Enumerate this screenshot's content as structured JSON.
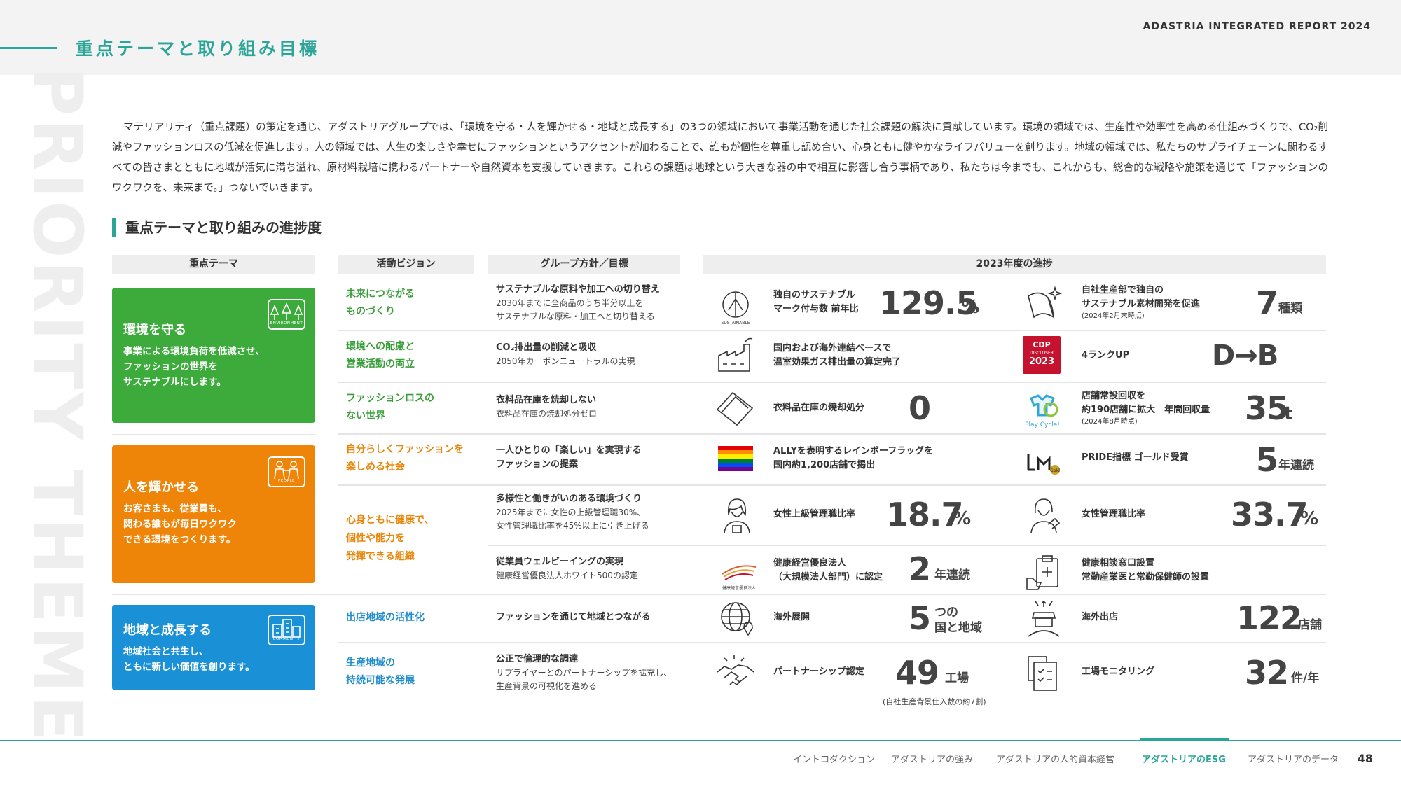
{
  "header": {
    "page_heading": "重点テーマと取り組み目標",
    "report_title": "ADASTRIA INTEGRATED REPORT 2024",
    "vertical_text": "PRIORITY THEME"
  },
  "intro": "マテリアリティ（重点課題）の策定を通じ、アダストリアグループでは、「環境を守る・人を輝かせる・地域と成長する」の3つの領域において事業活動を通じた社会課題の解決に貢献しています。環境の領域では、生産性や効率性を高める仕組みづくりで、CO₂削減やファッションロスの低減を促進します。人の領域では、人生の楽しさや幸せにファッションというアクセントが加わることで、誰もが個性を尊重し認め合い、心身ともに健やかなライフバリューを創ります。地域の領域では、私たちのサプライチェーンに関わるすべての皆さまとともに地域が活気に満ち溢れ、原材料栽培に携わるパートナーや自然資本を支援していきます。これらの課題は地球という大きな器の中で相互に影響し合う事柄であり、私たちは今までも、これからも、総合的な戦略や施策を通じて「ファッションのワクワクを、未来まで。」つないでいきます。",
  "section_title": "重点テーマと取り組みの進捗度",
  "columns": {
    "theme": "重点テーマ",
    "vision": "活動ビジョン",
    "policy": "グループ方針／目標",
    "progress": "2023年度の進捗"
  },
  "themes": {
    "env": {
      "title": "環境を守る",
      "desc1": "事業による環境負荷を低減させ、",
      "desc2": "ファッションの世界を",
      "desc3": "サステナブルにします。",
      "icon_label": "ENVIRONMENT",
      "color": "#3cab3c"
    },
    "people": {
      "title": "人を輝かせる",
      "desc1": "お客さまも、従業員も、",
      "desc2": "関わる誰もが毎日ワクワク",
      "desc3": "できる環境をつくります。",
      "icon_label": "PEOPLE",
      "color": "#ee8408"
    },
    "community": {
      "title": "地域と成長する",
      "desc1": "地域社会と共生し、",
      "desc2": "ともに新しい価値を創ります。",
      "icon_label": "COMMUNITY",
      "color": "#1a90d6"
    }
  },
  "visions": {
    "v1a": "未来につながる",
    "v1b": "ものづくり",
    "v2a": "環境への配慮と",
    "v2b": "営業活動の両立",
    "v3a": "ファッションロスの",
    "v3b": "ない世界",
    "v4a": "自分らしくファッションを",
    "v4b": "楽しめる社会",
    "v5a": "心身ともに健康で、",
    "v5b": "個性や能力を",
    "v5c": "発揮できる組織",
    "v6a": "出店地域の活性化",
    "v7a": "生産地域の",
    "v7b": "持続可能な発展"
  },
  "policies": {
    "p1t": "サステナブルな原料や加工への切り替え",
    "p1d1": "2030年までに全商品のうち半分以上を",
    "p1d2": "サステナブルな原料・加工へと切り替える",
    "p2t": "CO₂排出量の削減と吸収",
    "p2d1": "2050年カーボンニュートラルの実現",
    "p3t": "衣料品在庫を焼却しない",
    "p3d1": "衣料品在庫の焼却処分ゼロ",
    "p4t1": "一人ひとりの「楽しい」を実現する",
    "p4t2": "ファッションの提案",
    "p5t": "多様性と働きがいのある環境づくり",
    "p5d1": "2025年までに女性の上級管理職30%、",
    "p5d2": "女性管理職比率を45%以上に引き上げる",
    "p6t": "従業員ウェルビーイングの実現",
    "p6d1": "健康経営優良法人ホワイト500の認定",
    "p7t": "ファッションを通じて地域とつながる",
    "p8t": "公正で倫理的な調達",
    "p8d1": "サプライヤーとのパートナーシップを拡充し、",
    "p8d2": "生産背景の可視化を進める"
  },
  "progress": {
    "r1a_label1": "独自のサステナブル",
    "r1a_label2": "マーク付与数 前年比",
    "r1a_value": "129.5",
    "r1a_unit": "%",
    "r1b_label1": "自社生産部で独自の",
    "r1b_label2": "サステナブル素材開発を促進",
    "r1b_note": "(2024年2月末時点)",
    "r1b_value": "7",
    "r1b_unit": "種類",
    "r2a_label1": "国内および海外連結ベースで",
    "r2a_label2": "温室効果ガス排出量の算定完了",
    "r2b_label1": "4ランクUP",
    "r2b_value": "D→B",
    "cdp_line1": "CDP",
    "cdp_line2": "DISCLOSER",
    "cdp_line3": "2023",
    "r3a_label1": "衣料品在庫の焼却処分",
    "r3a_value": "0",
    "r3b_label1": "店舗常設回収を",
    "r3b_label2": "約190店舗に拡大　年間回収量",
    "r3b_note": "(2024年8月時点)",
    "r3b_value": "35",
    "r3b_unit": "t",
    "playcycle": "Play Cycle!",
    "r4a_label1": "ALLYを表明するレインボーフラッグを",
    "r4a_label2": "国内約1,200店舗で掲出",
    "r4b_label1": "PRIDE指標 ゴールド受賞",
    "r4b_value": "5",
    "r4b_unit": "年連続",
    "r5a_label1": "女性上級管理職比率",
    "r5a_value": "18.7",
    "r5a_unit": "%",
    "r5b_label1": "女性管理職比率",
    "r5b_value": "33.7",
    "r5b_unit": "%",
    "r6a_label1": "健康経営優良法人",
    "r6a_label2": "（大規模法人部門）に認定",
    "r6a_value": "2",
    "r6a_unit": "年連続",
    "r6b_label1": "健康相談窓口設置",
    "r6b_label2": "常勤産業医と常勤保健師の設置",
    "r7a_label1": "海外展開",
    "r7a_value": "5",
    "r7a_unit1": "つの",
    "r7a_unit2": "国と地域",
    "r7b_label1": "海外出店",
    "r7b_value": "122",
    "r7b_unit": "店舗",
    "r8a_label1": "パートナーシップ認定",
    "r8a_value": "49",
    "r8a_unit": "工場",
    "r8a_note": "(自社生産背景仕入数の約7割)",
    "r8b_label1": "工場モニタリング",
    "r8b_value": "32",
    "r8b_unit": "件/年"
  },
  "footer": {
    "nav1": "イントロダクション",
    "nav2": "アダストリアの強み",
    "nav3": "アダストリアの人的資本経営",
    "nav4": "アダストリアのESG",
    "nav5": "アダストリアのデータ",
    "page": "48"
  }
}
